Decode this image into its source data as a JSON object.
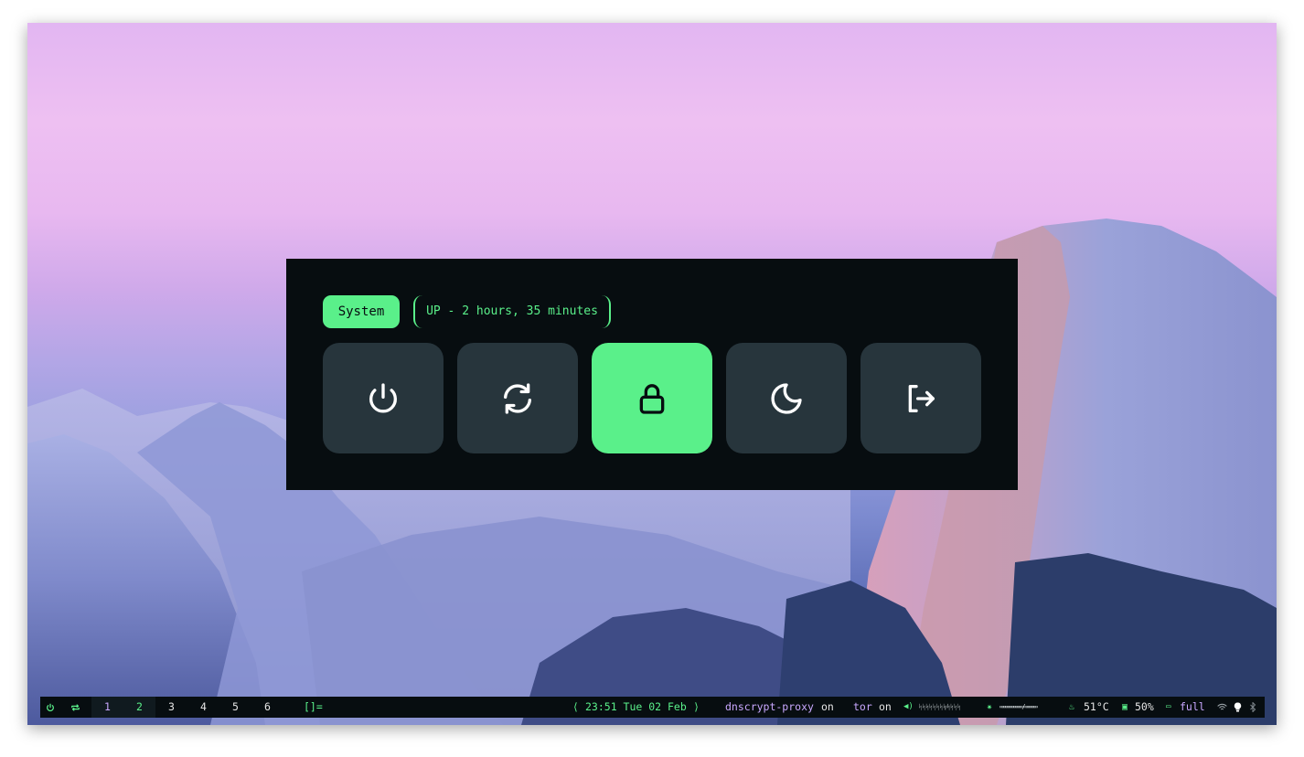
{
  "menu": {
    "system_label": "System",
    "uptime_text": "UP - 2 hours, 35 minutes",
    "buttons": [
      {
        "name": "power-icon",
        "active": false
      },
      {
        "name": "reboot-icon",
        "active": false
      },
      {
        "name": "lock-icon",
        "active": true
      },
      {
        "name": "suspend-icon",
        "active": false
      },
      {
        "name": "logout-icon",
        "active": false
      }
    ]
  },
  "bar": {
    "left_icons": [
      "power-icon",
      "repeat-icon"
    ],
    "workspaces": [
      "1",
      "2",
      "3",
      "4",
      "5",
      "6"
    ],
    "layout": "[]=",
    "clock": "23:51 Tue 02 Feb",
    "dnscrypt_label": "dnscrypt-proxy",
    "dnscrypt_state": "on",
    "tor_label": "tor",
    "tor_state": "on",
    "volume_text": "ᛋᛋᛋᛋᛋᛋᛋᛋ⁄ᛋᛋᛋᛋ",
    "brightness_text": "▭▭▭▭▭▭▭▭▭▭▭/▭▭▭▭▭▭",
    "temperature": "51°C",
    "cpu": "50%",
    "battery": "full",
    "colors": {
      "accent": "#5af08a",
      "purple": "#c9a8ff",
      "panel": "#070d10",
      "tile": "#27353c"
    }
  }
}
